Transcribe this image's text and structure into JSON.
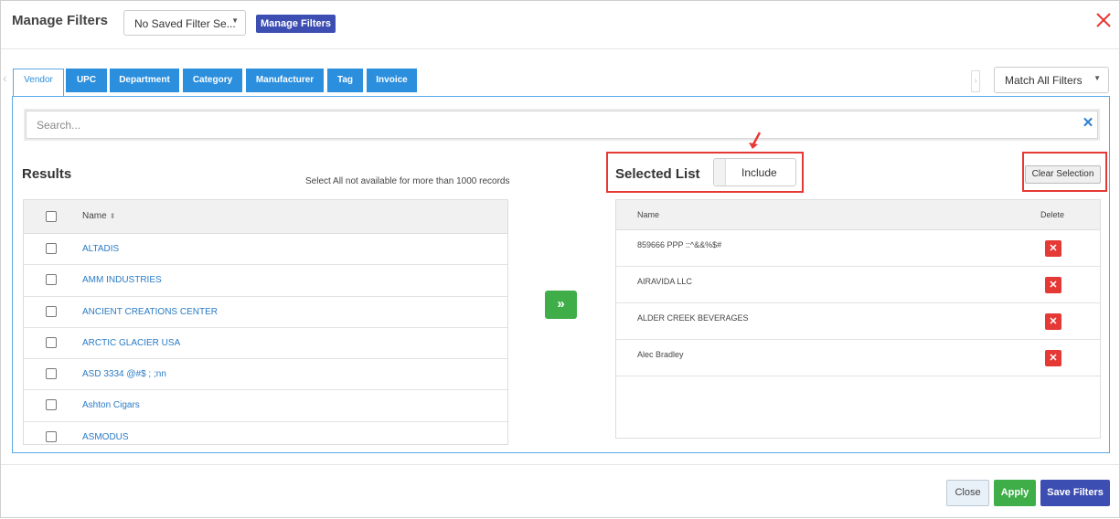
{
  "header": {
    "title": "Manage Filters",
    "saved_filter_value": "No Saved Filter Se...",
    "manage_filters_label": "Manage Filters"
  },
  "tabs": [
    {
      "label": "Vendor",
      "active": true
    },
    {
      "label": "UPC",
      "active": false
    },
    {
      "label": "Department",
      "active": false
    },
    {
      "label": "Category",
      "active": false
    },
    {
      "label": "Manufacturer",
      "active": false
    },
    {
      "label": "Tag",
      "active": false
    },
    {
      "label": "Invoice",
      "active": false
    }
  ],
  "match_mode": {
    "value": "Match All Filters"
  },
  "search": {
    "placeholder": "Search...",
    "value": ""
  },
  "results": {
    "title": "Results",
    "note": "Select All not available for more than 1000 records",
    "column_name": "Name",
    "items": [
      "ALTADIS",
      "AMM INDUSTRIES",
      "ANCIENT CREATIONS CENTER",
      "ARCTIC GLACIER USA",
      "ASD 3334 @#$ ; ;nn",
      "Ashton Cigars",
      "ASMODUS"
    ]
  },
  "move_button_label": "»",
  "selected": {
    "title": "Selected List",
    "toggle_label": "Include",
    "clear_label": "Clear Selection",
    "column_name": "Name",
    "column_delete": "Delete",
    "items": [
      "859666 PPP ::^&&%$#",
      "AIRAVIDA LLC",
      "ALDER CREEK BEVERAGES",
      "Alec Bradley"
    ]
  },
  "footer": {
    "close_label": "Close",
    "apply_label": "Apply",
    "save_label": "Save Filters"
  },
  "colors": {
    "tab_blue": "#2b8fde",
    "brand_indigo": "#3d4eb2",
    "success_green": "#3fae49",
    "danger_red": "#e53935",
    "link_blue": "#2a7bc5"
  }
}
